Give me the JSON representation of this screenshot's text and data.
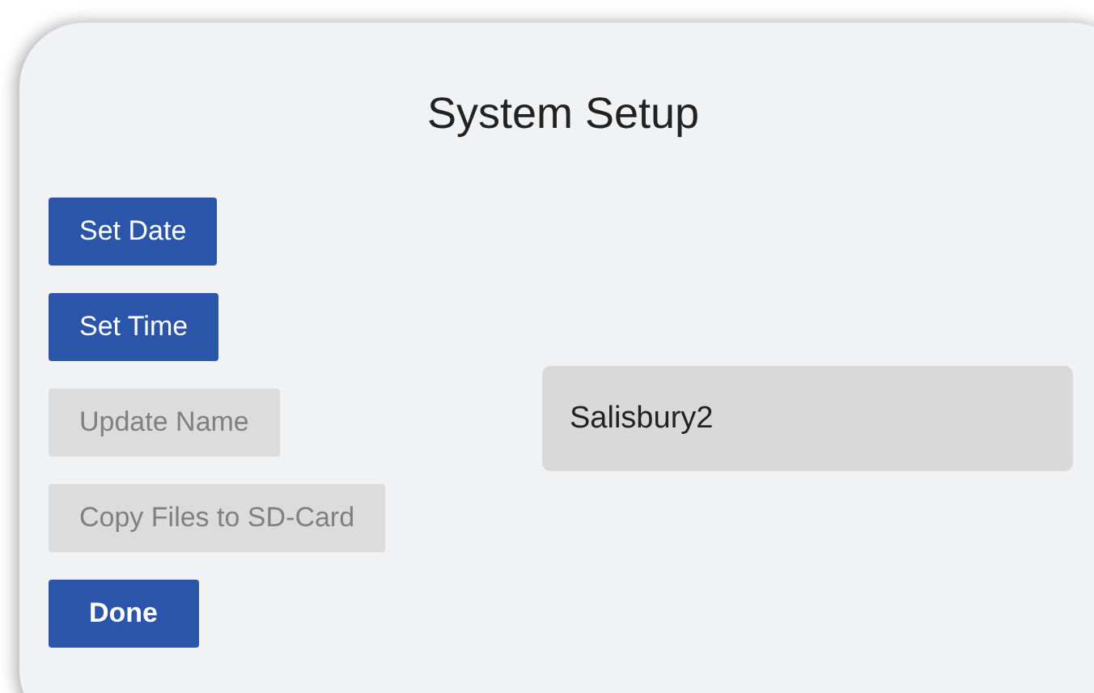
{
  "title": "System Setup",
  "buttons": [
    {
      "label": "Set Date",
      "kind": "action",
      "disabled": false
    },
    {
      "label": "Set Time",
      "kind": "action",
      "disabled": false
    },
    {
      "label": "Update Name",
      "kind": "action",
      "disabled": true
    },
    {
      "label": "Copy Files to SD-Card",
      "kind": "action",
      "disabled": true
    },
    {
      "label": "Done",
      "kind": "primary",
      "disabled": false
    }
  ],
  "name_field": {
    "value": "Salisbury2"
  }
}
